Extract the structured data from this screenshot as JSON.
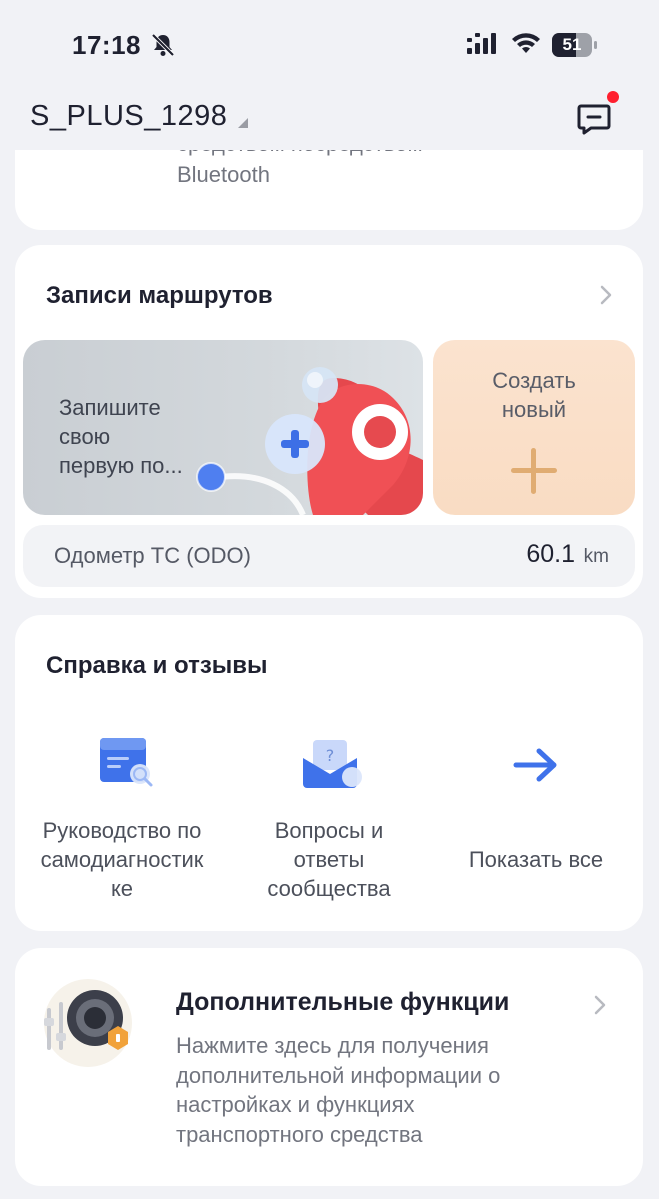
{
  "status_bar": {
    "time": "17:18",
    "battery": "51"
  },
  "header": {
    "device_name": "S_PLUS_1298"
  },
  "top_card": {
    "text_line1": "средством посредством",
    "text_line2": "Bluetooth"
  },
  "routes": {
    "title": "Записи маршрутов",
    "banner_text": "Запишите своюпервую по...",
    "banner_lines": [
      "Запишите",
      "свою",
      "первую по..."
    ],
    "create_lines": [
      "Создать",
      "новый"
    ],
    "odometer_label": "Одометр ТС (ODO)",
    "odometer_value": "60.1",
    "odometer_unit": "km"
  },
  "help": {
    "title": "Справка и отзывы",
    "items": [
      {
        "lines": [
          "Руководство по",
          "самодиагностик",
          "ке"
        ],
        "icon": "guide-icon"
      },
      {
        "lines": [
          "Вопросы и",
          "ответы",
          "сообщества"
        ],
        "icon": "community-icon"
      },
      {
        "lines": [
          "Показать все"
        ],
        "icon": "arrow-right-icon"
      }
    ]
  },
  "extra": {
    "title": "Дополнительные функции",
    "desc_lines": [
      "Нажмите здесь для получения",
      "дополнительной информации о",
      "настройках и функциях",
      "транспортного средства"
    ]
  },
  "colors": {
    "accent_blue": "#2f6ee8",
    "alert_red": "#ff1f2e",
    "create_bg": "#fbe3cf"
  }
}
